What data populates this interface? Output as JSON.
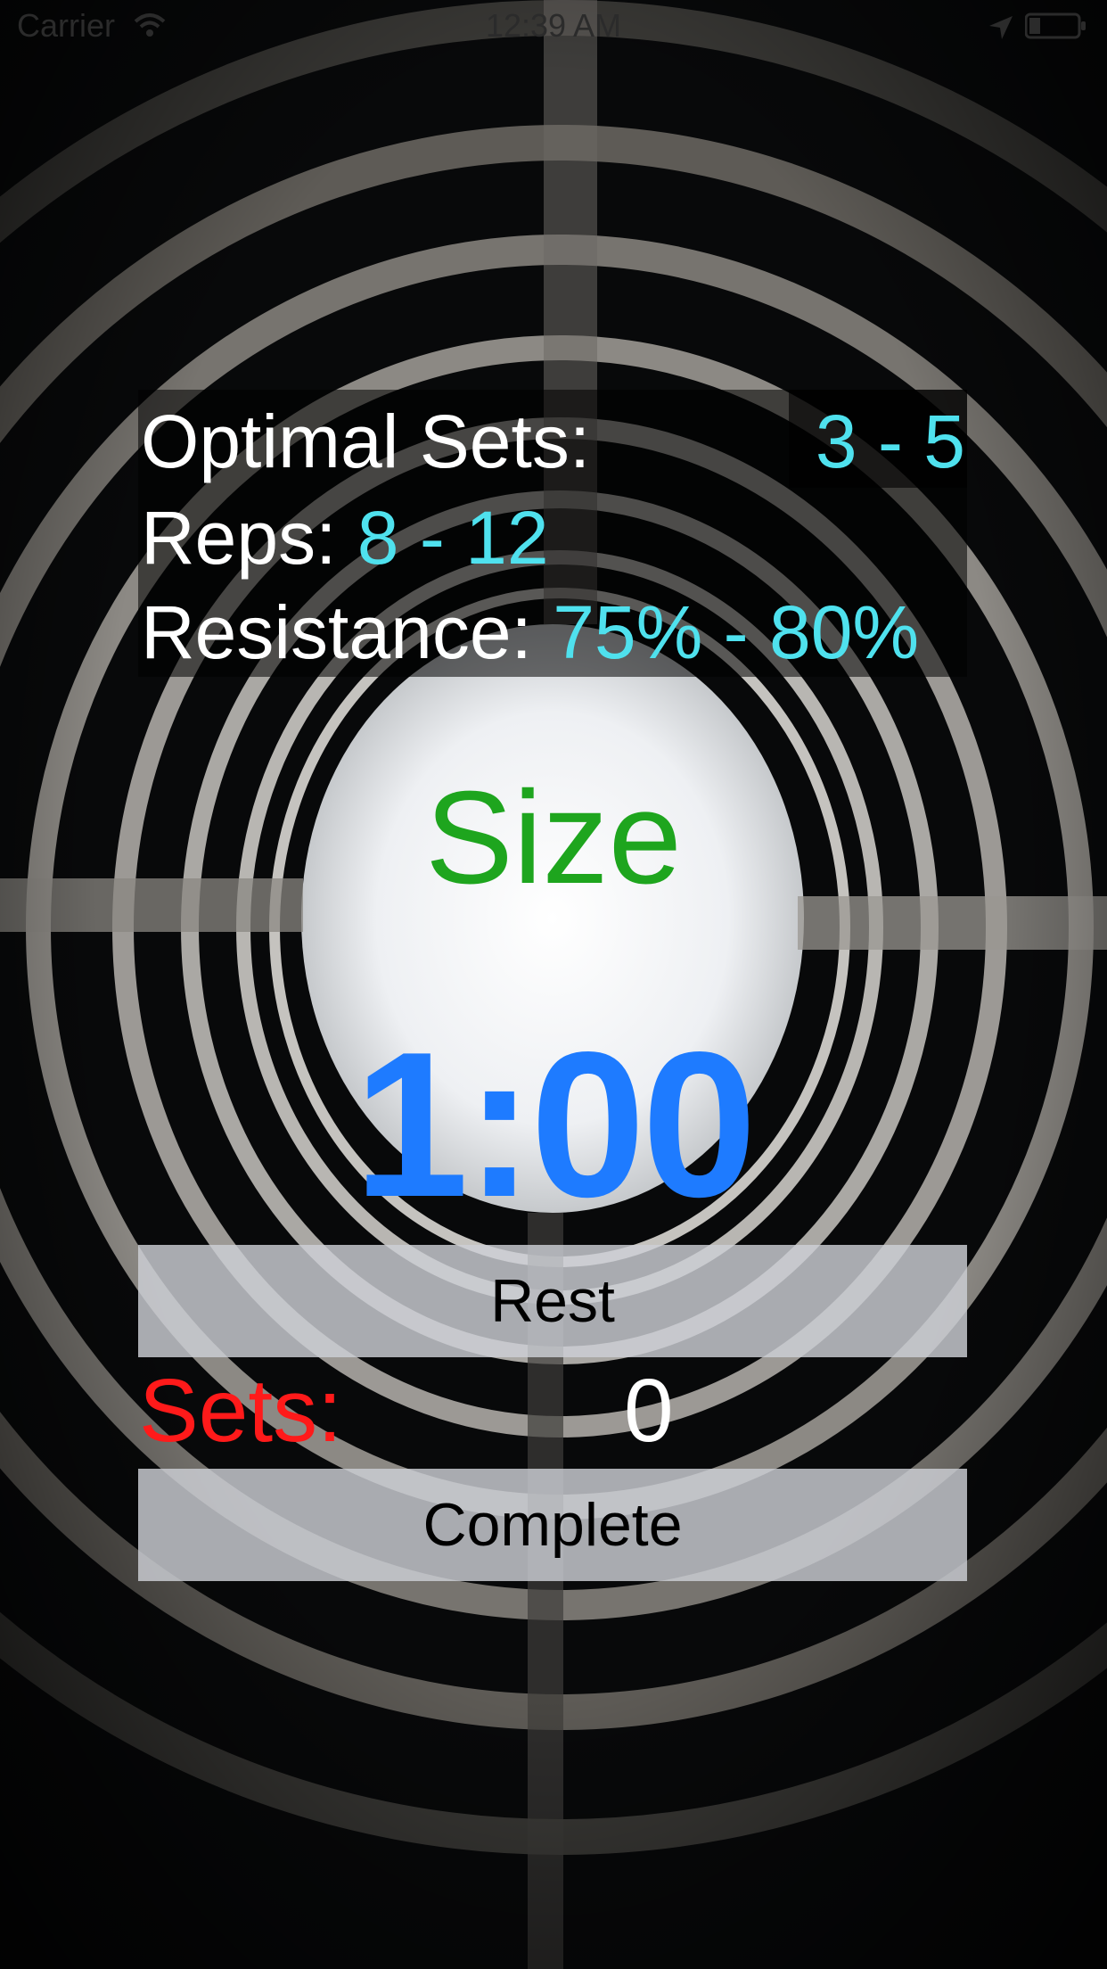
{
  "status_bar": {
    "carrier": "Carrier",
    "time": "12:39 AM"
  },
  "workout_info": {
    "sets_label": "Optimal Sets:",
    "sets_value": "3 - 5",
    "reps_label": "Reps:",
    "reps_value": "8 - 12",
    "resistance_label": "Resistance:",
    "resistance_value": "75% - 80%"
  },
  "goal": "Size",
  "timer": "1:00",
  "rest_button": "Rest",
  "sets_counter": {
    "label": "Sets:",
    "value": "0"
  },
  "complete_button": "Complete",
  "colors": {
    "accent_cyan": "#4fe1ee",
    "goal_green": "#1ea51e",
    "timer_blue": "#1e7bff",
    "sets_red": "#ff1a1a",
    "button_gray": "#cdcfd6"
  },
  "icons": [
    "wifi-icon",
    "location-arrow-icon",
    "battery-icon"
  ]
}
